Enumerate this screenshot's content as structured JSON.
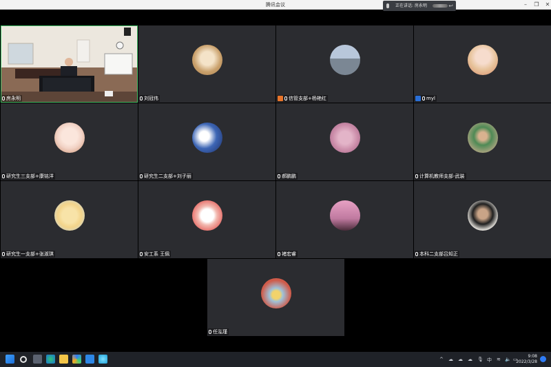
{
  "window": {
    "title": "腾讯会议"
  },
  "speaking_indicator": {
    "label": "正在讲话: 房永明"
  },
  "participants": [
    {
      "name": "房永明",
      "avatar": "video-feed"
    },
    {
      "name": "刘冠伟",
      "avatar": "puppy",
      "color": "#c9a06b"
    },
    {
      "name": "信管支部+杨艳红",
      "avatar": "rocks",
      "color": "#8fa8c6",
      "role": "host"
    },
    {
      "name": "myl",
      "avatar": "cartoon-girl",
      "color": "#e7c39b",
      "role": "co-host"
    },
    {
      "name": "研究生三支部+康铭洋",
      "avatar": "cartoon-girl",
      "color": "#f2d3c6"
    },
    {
      "name": "研究生二支部+刘子丽",
      "avatar": "anime-blue",
      "color": "#3d66b5"
    },
    {
      "name": "郝鹏鹏",
      "avatar": "pink-blossom",
      "color": "#c98aa7"
    },
    {
      "name": "计算机教师支部-武装",
      "avatar": "child",
      "color": "#9fa07a"
    },
    {
      "name": "研究生一支部+张淑琪",
      "avatar": "cartoon-yellow",
      "color": "#f3d48a"
    },
    {
      "name": "安工系 王佩",
      "avatar": "cartoon-girl-red",
      "color": "#e87a74"
    },
    {
      "name": "褚宏睿",
      "avatar": "tower-sunset",
      "color": "#c07aa0"
    },
    {
      "name": "本科二支部吕知正",
      "avatar": "man",
      "color": "#d9d6d0"
    },
    {
      "name": "任泓瑾",
      "avatar": "cartoon",
      "color": "#cf5b4a"
    }
  ],
  "taskbar": {
    "apps": [
      "windows-start",
      "search",
      "task-view",
      "edge",
      "file-explorer",
      "tencent-meeting",
      "store",
      "browser"
    ],
    "tray": {
      "lang": "中"
    },
    "clock": {
      "time": "9:08",
      "date": "2022/3/28"
    }
  },
  "colors": {
    "tile": "#2b2c30",
    "active_border": "#46c26a",
    "host": "#e8742a",
    "cohost": "#2a6fd6"
  }
}
